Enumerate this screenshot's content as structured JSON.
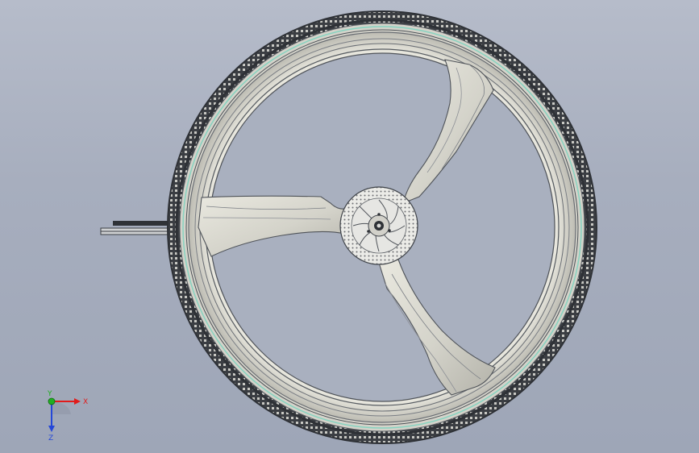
{
  "viewport": {
    "background_top": "#b6bcca",
    "background_bottom": "#9ea6b7"
  },
  "model": {
    "parts": [
      "tire",
      "rim",
      "three-spoke-wheel",
      "brake-disc",
      "hub",
      "axle-shaft"
    ],
    "colors": {
      "tire": "#2e3136",
      "rim_outline": "#6a6e74",
      "rim_face": "#d9d8cf",
      "spoke_face": "#dcdbd2",
      "spoke_shade": "#b6b5ac",
      "rim_accent": "#86d3c0",
      "disc": "#e6e6e3"
    }
  },
  "triad": {
    "x_label": "X",
    "y_label": "Y",
    "z_label": "Z",
    "x_color": "#e11b1b",
    "y_color": "#21b021",
    "z_color": "#2447d8"
  }
}
